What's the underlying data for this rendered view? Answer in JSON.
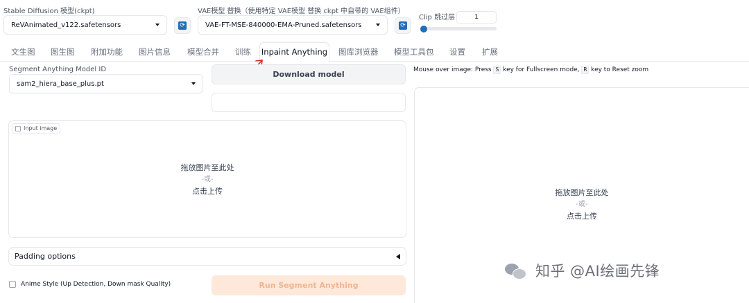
{
  "settings": {
    "checkpoint_label": "Stable Diffusion 模型(ckpt)",
    "checkpoint_value": "ReVAnimated_v122.safetensors",
    "vae_label": "VAE模型 替换（使用特定 VAE模型 替换 ckpt 中自带的 VAE组件）",
    "vae_value": "VAE-FT-MSE-840000-EMA-Pruned.safetensors",
    "clip_label": "Clip 跳过层",
    "clip_value": "1",
    "clip_fraction": 0
  },
  "tabs": [
    {
      "label": "文生图"
    },
    {
      "label": "图生图"
    },
    {
      "label": "附加功能"
    },
    {
      "label": "图片信息"
    },
    {
      "label": "模型合并"
    },
    {
      "label": "训练"
    },
    {
      "label": "Inpaint Anything"
    },
    {
      "label": "图库浏览器"
    },
    {
      "label": "模型工具包"
    },
    {
      "label": "设置"
    },
    {
      "label": "扩展"
    }
  ],
  "active_tab": "Inpaint Anything",
  "left": {
    "sam_label": "Segment Anything Model ID",
    "sam_value": "sam2_hiera_base_plus.pt",
    "download_label": "Download model",
    "input_image_label": "Input image",
    "drop_line1": "拖放图片至此处",
    "drop_or": "-或-",
    "drop_line2": "点击上传",
    "padding_label": "Padding options",
    "anime_label": "Anime Style (Up Detection, Down mask Quality)",
    "run_label": "Run Segment Anything"
  },
  "right": {
    "hint_pre": "Mouse over image: Press",
    "hint_key1": "S",
    "hint_mid": "key for Fullscreen mode,",
    "hint_key2": "R",
    "hint_post": "key to Reset zoom",
    "drop_line1": "拖放图片至此处",
    "drop_or": "-或-",
    "drop_line2": "点击上传"
  },
  "watermark": {
    "text": "知乎 @AI绘画先锋"
  },
  "colors": {
    "accent": "#1d6fb8",
    "arrow": "#e02424",
    "run_button_bg": "#fde8da",
    "run_button_text": "#f2b48f"
  }
}
